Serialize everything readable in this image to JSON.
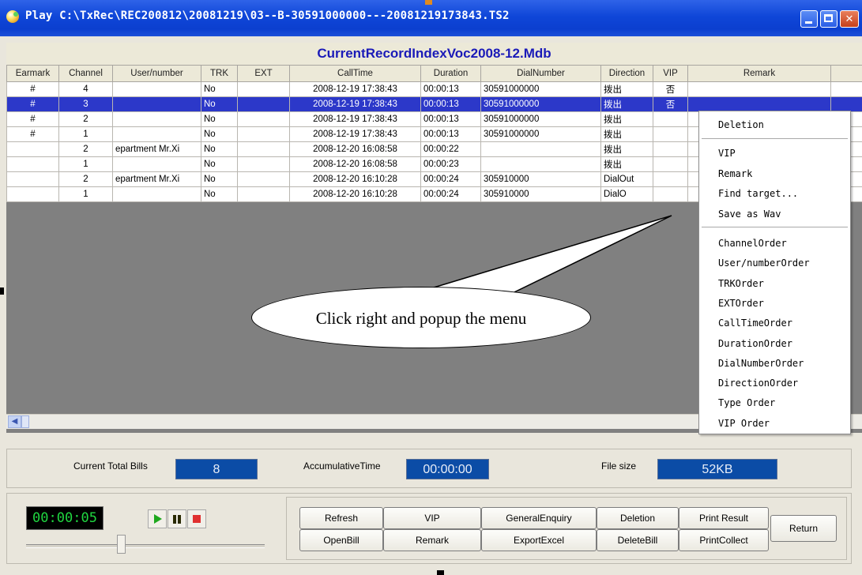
{
  "window": {
    "title": "Play   C:\\TxRec\\REC200812\\20081219\\03--B-30591000000---20081219173843.TS2",
    "title_color": "#0b3fcf"
  },
  "records": {
    "caption": "CurrentRecordIndexVoc2008-12.Mdb",
    "columns": [
      "Earmark",
      "Channel",
      "User/number",
      "TRK",
      "EXT",
      "CallTime",
      "Duration",
      "DialNumber",
      "Direction",
      "VIP",
      "Remark"
    ],
    "rows": [
      {
        "earmark": "#",
        "channel": "4",
        "user": "",
        "trk": "No",
        "ext": "",
        "calltime": "2008-12-19 17:38:43",
        "duration": "00:00:13",
        "dial": "30591000000",
        "direction": "拨出",
        "vip": "否",
        "remark": ""
      },
      {
        "earmark": "#",
        "channel": "3",
        "user": "",
        "trk": "No",
        "ext": "",
        "calltime": "2008-12-19 17:38:43",
        "duration": "00:00:13",
        "dial": "30591000000",
        "direction": "拨出",
        "vip": "否",
        "remark": ""
      },
      {
        "earmark": "#",
        "channel": "2",
        "user": "",
        "trk": "No",
        "ext": "",
        "calltime": "2008-12-19 17:38:43",
        "duration": "00:00:13",
        "dial": "30591000000",
        "direction": "拨出",
        "vip": "",
        "remark": ""
      },
      {
        "earmark": "#",
        "channel": "1",
        "user": "",
        "trk": "No",
        "ext": "",
        "calltime": "2008-12-19 17:38:43",
        "duration": "00:00:13",
        "dial": "30591000000",
        "direction": "拨出",
        "vip": "",
        "remark": ""
      },
      {
        "earmark": "",
        "channel": "2",
        "user": "epartment Mr.Xi",
        "trk": "No",
        "ext": "",
        "calltime": "2008-12-20 16:08:58",
        "duration": "00:00:22",
        "dial": "",
        "direction": "拨出",
        "vip": "",
        "remark": ""
      },
      {
        "earmark": "",
        "channel": "1",
        "user": "",
        "trk": "No",
        "ext": "",
        "calltime": "2008-12-20 16:08:58",
        "duration": "00:00:23",
        "dial": "",
        "direction": "拨出",
        "vip": "",
        "remark": ""
      },
      {
        "earmark": "",
        "channel": "2",
        "user": "epartment Mr.Xi",
        "trk": "No",
        "ext": "",
        "calltime": "2008-12-20 16:10:28",
        "duration": "00:00:24",
        "dial": "305910000",
        "direction": "DialOut",
        "vip": "",
        "remark": ""
      },
      {
        "earmark": "",
        "channel": "1",
        "user": "",
        "trk": "No",
        "ext": "",
        "calltime": "2008-12-20 16:10:28",
        "duration": "00:00:24",
        "dial": "305910000",
        "direction": "DialO",
        "vip": "",
        "remark": ""
      }
    ],
    "selected_row": 1,
    "selection_color": "#2c38c9"
  },
  "callout": {
    "text": "Click right and popup the menu"
  },
  "context_menu": {
    "group1": [
      "Deletion"
    ],
    "group2": [
      "VIP",
      "Remark",
      "Find target...",
      "Save as Wav"
    ],
    "group3": [
      "ChannelOrder",
      "User/numberOrder",
      "TRKOrder",
      "EXTOrder",
      "CallTimeOrder",
      "DurationOrder",
      "DialNumberOrder",
      "DirectionOrder",
      "Type Order",
      "VIP Order"
    ]
  },
  "status": {
    "total_label": "Current Total Bills",
    "total_value": "8",
    "accum_label": "AccumulativeTime",
    "accum_value": "00:00:00",
    "size_label": "File size",
    "size_value": "52KB",
    "value_color": "#0b4ca6"
  },
  "player": {
    "time": "00:00:05",
    "time_color": "#20d640",
    "play_icon": "play-icon",
    "pause_icon": "pause-icon",
    "stop_icon": "stop-icon",
    "position_fraction": 0.4
  },
  "actions": {
    "row1": [
      "Refresh",
      "VIP",
      "GeneralEnquiry",
      "Deletion",
      "Print Result"
    ],
    "row2": [
      "OpenBill",
      "Remark",
      "ExportExcel",
      "DeleteBill",
      "PrintCollect"
    ],
    "return_label": "Return"
  }
}
